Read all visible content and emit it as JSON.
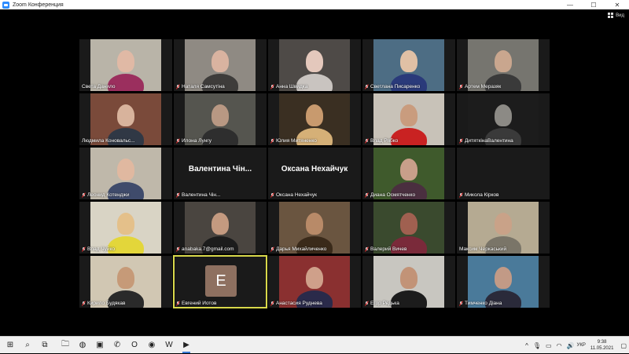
{
  "window": {
    "title": "Zoom Конференция",
    "min": "—",
    "max": "☐",
    "close": "✕"
  },
  "view_button": {
    "label": "Вид"
  },
  "participants": [
    {
      "name": "Света Данило",
      "muted": false,
      "bg": "#b9b4a8",
      "skin": "#e0b9a5",
      "shirt": "#9b2f5e"
    },
    {
      "name": "Наталя Самсутіна",
      "muted": true,
      "bg": "#8f8a83",
      "skin": "#d9b3a0",
      "shirt": "#3e3c3a"
    },
    {
      "name": "Анна Швидка",
      "muted": true,
      "bg": "#4e4a47",
      "skin": "#e4c8bc",
      "shirt": "#c9c4c0"
    },
    {
      "name": "Светлана Писаренко",
      "muted": true,
      "bg": "#4d6d84",
      "skin": "#e0c0a5",
      "shirt": "#2a3a7a"
    },
    {
      "name": "Артем Меразяк",
      "muted": true,
      "bg": "#76756f",
      "skin": "#c9a68e",
      "shirt": "#3a3a3a"
    },
    {
      "name": "Людмила Коновальс...",
      "muted": false,
      "bg": "#7a4a3a",
      "skin": "#d8b39c",
      "shirt": "#303845"
    },
    {
      "name": "Илона Лунгу",
      "muted": true,
      "bg": "#55554f",
      "skin": "#b89883",
      "shirt": "#2e2e2e"
    },
    {
      "name": "Юлия Митяненко",
      "muted": true,
      "bg": "#3a2f22",
      "skin": "#c89a6e",
      "shirt": "#d5b077"
    },
    {
      "name": "Влад Рябко",
      "muted": true,
      "bg": "#c8c2b8",
      "skin": "#c99c7e",
      "shirt": "#c92222"
    },
    {
      "name": "ДитяткінаВалентина",
      "muted": true,
      "bg": "#1c1c1c",
      "skin": "#8c8a85",
      "shirt": "#3a3a3a"
    },
    {
      "name": "Леонид Котенджи",
      "muted": true,
      "bg": "#bfb8aa",
      "skin": "#e0b8a0",
      "shirt": "#3f4b6b"
    },
    {
      "name": "Валентина Чін...",
      "muted": true,
      "bg": "#1a1a1a",
      "big": true
    },
    {
      "name": "Оксана Нехайчук",
      "muted": true,
      "bg": "#1a1a1a",
      "big": true
    },
    {
      "name": "Диана Осмятченко",
      "muted": true,
      "bg": "#3f5a2c",
      "skin": "#c89f8a",
      "shirt": "#4a2f3f"
    },
    {
      "name": "Микола Кірков",
      "muted": true,
      "bg": "#1a1a1a"
    },
    {
      "name": "Влад Чуйко",
      "muted": true,
      "bg": "#d9d4c5",
      "skin": "#e4c08a",
      "shirt": "#e3d63a"
    },
    {
      "name": "anabaka.7@gmail.com",
      "muted": true,
      "bg": "#4a4540",
      "skin": "#c49a80",
      "shirt": "#1c1c1c"
    },
    {
      "name": "Дарья Михайличенко",
      "muted": true,
      "bg": "#6a5540",
      "skin": "#b88a68",
      "shirt": "#3a2a1a"
    },
    {
      "name": "Валерий Вичев",
      "muted": true,
      "bg": "#3a4a2e",
      "skin": "#a06050",
      "shirt": "#7a2a3a"
    },
    {
      "name": "Максим Черкаський",
      "muted": false,
      "bg": "#b5aa92",
      "skin": "#c9a288",
      "shirt": "#7a7568"
    },
    {
      "name": "Кирило Будякав",
      "muted": true,
      "bg": "#d1c7b3",
      "skin": "#c69a78",
      "shirt": "#2a2a2a"
    },
    {
      "name": "Евгений Иотов",
      "muted": true,
      "bg": "#1a1a1a",
      "avatar": "E",
      "active": true
    },
    {
      "name": "Анастасия Руднева",
      "muted": true,
      "bg": "#8a3030",
      "skin": "#cfa08a",
      "shirt": "#2a2a4a"
    },
    {
      "name": "Егор Редька",
      "muted": true,
      "bg": "#c8c6c0",
      "skin": "#c29377",
      "shirt": "#1c1c1c"
    },
    {
      "name": "Тимченко Діана",
      "muted": true,
      "bg": "#4a7a9a",
      "skin": "#c29a86",
      "shirt": "#2a2a3a"
    }
  ],
  "taskbar": {
    "items": [
      {
        "icon": "windows-start-icon",
        "glyph": "⊞"
      },
      {
        "icon": "search-icon",
        "glyph": "⌕"
      },
      {
        "icon": "task-view-icon",
        "glyph": "⧉"
      },
      {
        "icon": "file-explorer-icon",
        "glyph": "🗀"
      },
      {
        "icon": "edge-icon",
        "glyph": "◍"
      },
      {
        "icon": "store-icon",
        "glyph": "▣"
      },
      {
        "icon": "viber-icon",
        "glyph": "✆"
      },
      {
        "icon": "opera-icon",
        "glyph": "O"
      },
      {
        "icon": "chrome-icon",
        "glyph": "◉"
      },
      {
        "icon": "word-icon",
        "glyph": "W"
      },
      {
        "icon": "zoom-icon",
        "glyph": "▶",
        "active": true
      }
    ],
    "language": "УКР",
    "time": "9:38",
    "date": "11.05.2021"
  }
}
